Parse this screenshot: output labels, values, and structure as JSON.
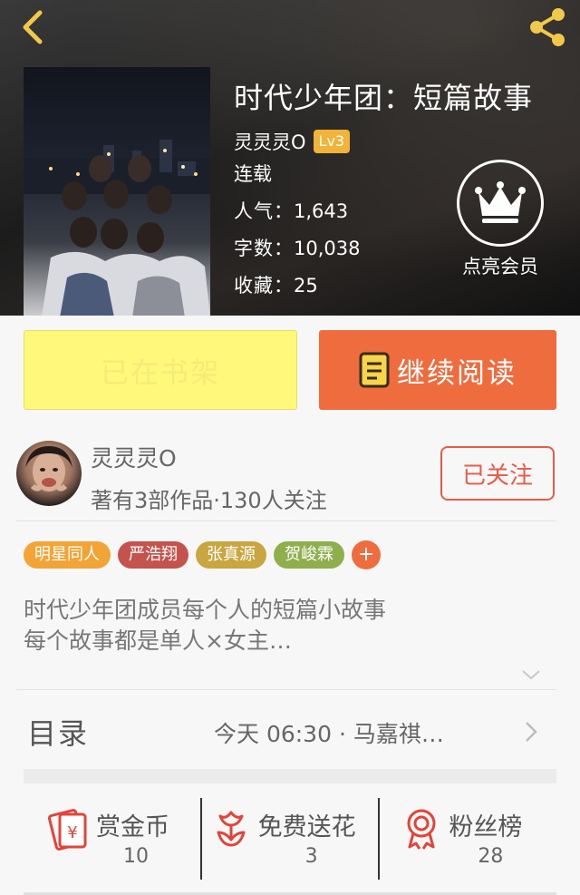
{
  "header": {
    "book_title": "时代少年团：短篇故事",
    "author": "灵灵灵O",
    "level": "Lv3",
    "status": "连载",
    "popularity_label": "人气：",
    "popularity_value": "1,643",
    "word_count_label": "字数：",
    "word_count_value": "10,038",
    "favorites_label": "收藏：",
    "favorites_value": "25",
    "vip_label": "点亮会员"
  },
  "actions": {
    "shelf_label": "已在书架",
    "read_label": "继续阅读"
  },
  "author_card": {
    "name": "灵灵灵O",
    "meta": "著有3部作品·130人关注",
    "follow_label": "已关注"
  },
  "tags": [
    {
      "label": "明星同人",
      "color": "#f2a536"
    },
    {
      "label": "严浩翔",
      "color": "#c4534d"
    },
    {
      "label": "张真源",
      "color": "#c9a640"
    },
    {
      "label": "贺峻霖",
      "color": "#8fae4c"
    }
  ],
  "tag_add_label": "+",
  "synopsis": {
    "line1": "时代少年团成员每个人的短篇小故事",
    "line2": "每个故事都是单人×女主…"
  },
  "catalog": {
    "label": "目录",
    "latest": "今天 06:30 · 马嘉祺…"
  },
  "stats": [
    {
      "label": "赏金币",
      "value": "10",
      "icon": "red-envelope-icon"
    },
    {
      "label": "免费送花",
      "value": "3",
      "icon": "flower-icon"
    },
    {
      "label": "粉丝榜",
      "value": "28",
      "icon": "medal-icon"
    }
  ],
  "colors": {
    "accent": "#ee6c3d",
    "shelf_yellow": "#fff87a",
    "follow_red": "#e85b48",
    "icon_red": "#e2443a",
    "badge_gold": "#f2b33a"
  }
}
